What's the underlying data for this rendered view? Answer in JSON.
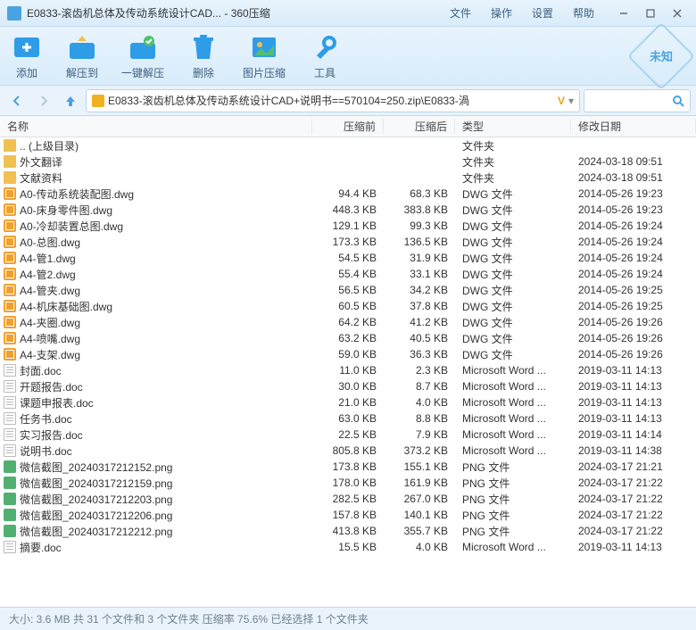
{
  "window": {
    "title": "E0833-滚齿机总体及传动系统设计CAD... - 360压缩"
  },
  "menu": {
    "file": "文件",
    "operate": "操作",
    "settings": "设置",
    "help": "帮助"
  },
  "toolbar": {
    "add": "添加",
    "extract": "解压到",
    "extractAll": "一键解压",
    "delete": "删除",
    "imgCompress": "图片压缩",
    "tools": "工具",
    "badge": "未知"
  },
  "path": "E0833-滚齿机总体及传动系统设计CAD+说明书==570104=250.zip\\E0833-渦",
  "columns": {
    "name": "名称",
    "pre": "压缩前",
    "post": "压缩后",
    "type": "类型",
    "date": "修改日期"
  },
  "files": [
    {
      "ico": "folder",
      "name": ".. (上级目录)",
      "pre": "",
      "post": "",
      "type": "文件夹",
      "date": ""
    },
    {
      "ico": "folder",
      "name": "外文翻译",
      "pre": "",
      "post": "",
      "type": "文件夹",
      "date": "2024-03-18 09:51"
    },
    {
      "ico": "folder",
      "name": "文献资料",
      "pre": "",
      "post": "",
      "type": "文件夹",
      "date": "2024-03-18 09:51"
    },
    {
      "ico": "dwg",
      "name": "A0-传动系统装配图.dwg",
      "pre": "94.4 KB",
      "post": "68.3 KB",
      "type": "DWG 文件",
      "date": "2014-05-26 19:23"
    },
    {
      "ico": "dwg",
      "name": "A0-床身零件图.dwg",
      "pre": "448.3 KB",
      "post": "383.8 KB",
      "type": "DWG 文件",
      "date": "2014-05-26 19:23"
    },
    {
      "ico": "dwg",
      "name": "A0-冷却装置总图.dwg",
      "pre": "129.1 KB",
      "post": "99.3 KB",
      "type": "DWG 文件",
      "date": "2014-05-26 19:24"
    },
    {
      "ico": "dwg",
      "name": "A0-总图.dwg",
      "pre": "173.3 KB",
      "post": "136.5 KB",
      "type": "DWG 文件",
      "date": "2014-05-26 19:24"
    },
    {
      "ico": "dwg",
      "name": "A4-管1.dwg",
      "pre": "54.5 KB",
      "post": "31.9 KB",
      "type": "DWG 文件",
      "date": "2014-05-26 19:24"
    },
    {
      "ico": "dwg",
      "name": "A4-管2.dwg",
      "pre": "55.4 KB",
      "post": "33.1 KB",
      "type": "DWG 文件",
      "date": "2014-05-26 19:24"
    },
    {
      "ico": "dwg",
      "name": "A4-管夹.dwg",
      "pre": "56.5 KB",
      "post": "34.2 KB",
      "type": "DWG 文件",
      "date": "2014-05-26 19:25"
    },
    {
      "ico": "dwg",
      "name": "A4-机床基础图.dwg",
      "pre": "60.5 KB",
      "post": "37.8 KB",
      "type": "DWG 文件",
      "date": "2014-05-26 19:25"
    },
    {
      "ico": "dwg",
      "name": "A4-夹圈.dwg",
      "pre": "64.2 KB",
      "post": "41.2 KB",
      "type": "DWG 文件",
      "date": "2014-05-26 19:26"
    },
    {
      "ico": "dwg",
      "name": "A4-喷嘴.dwg",
      "pre": "63.2 KB",
      "post": "40.5 KB",
      "type": "DWG 文件",
      "date": "2014-05-26 19:26"
    },
    {
      "ico": "dwg",
      "name": "A4-支架.dwg",
      "pre": "59.0 KB",
      "post": "36.3 KB",
      "type": "DWG 文件",
      "date": "2014-05-26 19:26"
    },
    {
      "ico": "doc",
      "name": "封面.doc",
      "pre": "11.0 KB",
      "post": "2.3 KB",
      "type": "Microsoft Word ...",
      "date": "2019-03-11 14:13"
    },
    {
      "ico": "doc",
      "name": "开题报告.doc",
      "pre": "30.0 KB",
      "post": "8.7 KB",
      "type": "Microsoft Word ...",
      "date": "2019-03-11 14:13"
    },
    {
      "ico": "doc",
      "name": "课题申报表.doc",
      "pre": "21.0 KB",
      "post": "4.0 KB",
      "type": "Microsoft Word ...",
      "date": "2019-03-11 14:13"
    },
    {
      "ico": "doc",
      "name": "任务书.doc",
      "pre": "63.0 KB",
      "post": "8.8 KB",
      "type": "Microsoft Word ...",
      "date": "2019-03-11 14:13"
    },
    {
      "ico": "doc",
      "name": "实习报告.doc",
      "pre": "22.5 KB",
      "post": "7.9 KB",
      "type": "Microsoft Word ...",
      "date": "2019-03-11 14:14"
    },
    {
      "ico": "doc",
      "name": "说明书.doc",
      "pre": "805.8 KB",
      "post": "373.2 KB",
      "type": "Microsoft Word ...",
      "date": "2019-03-11 14:38"
    },
    {
      "ico": "png",
      "name": "微信截图_20240317212152.png",
      "pre": "173.8 KB",
      "post": "155.1 KB",
      "type": "PNG 文件",
      "date": "2024-03-17 21:21"
    },
    {
      "ico": "png",
      "name": "微信截图_20240317212159.png",
      "pre": "178.0 KB",
      "post": "161.9 KB",
      "type": "PNG 文件",
      "date": "2024-03-17 21:22"
    },
    {
      "ico": "png",
      "name": "微信截图_20240317212203.png",
      "pre": "282.5 KB",
      "post": "267.0 KB",
      "type": "PNG 文件",
      "date": "2024-03-17 21:22"
    },
    {
      "ico": "png",
      "name": "微信截图_20240317212206.png",
      "pre": "157.8 KB",
      "post": "140.1 KB",
      "type": "PNG 文件",
      "date": "2024-03-17 21:22"
    },
    {
      "ico": "png",
      "name": "微信截图_20240317212212.png",
      "pre": "413.8 KB",
      "post": "355.7 KB",
      "type": "PNG 文件",
      "date": "2024-03-17 21:22"
    },
    {
      "ico": "doc",
      "name": "摘要.doc",
      "pre": "15.5 KB",
      "post": "4.0 KB",
      "type": "Microsoft Word ...",
      "date": "2019-03-11 14:13"
    }
  ],
  "status": "大小: 3.6 MB 共 31 个文件和 3 个文件夹 压缩率 75.6%  已经选择 1 个文件夹"
}
